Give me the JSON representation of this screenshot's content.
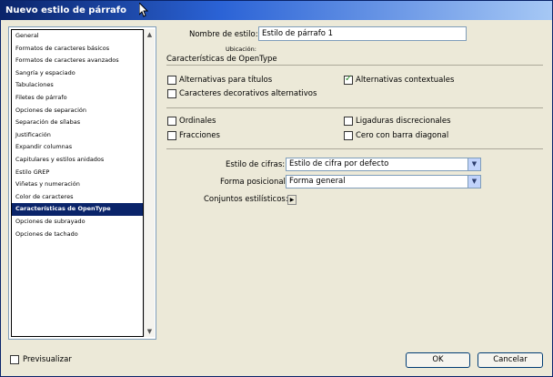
{
  "window": {
    "title": "Nuevo estilo de párrafo"
  },
  "sidebar": {
    "items": [
      {
        "label": "General"
      },
      {
        "label": "Formatos de caracteres básicos"
      },
      {
        "label": "Formatos de caracteres avanzados"
      },
      {
        "label": "Sangría y espaciado"
      },
      {
        "label": "Tabulaciones"
      },
      {
        "label": "Filetes de párrafo"
      },
      {
        "label": "Opciones de separación"
      },
      {
        "label": "Separación de sílabas"
      },
      {
        "label": "Justificación"
      },
      {
        "label": "Expandir columnas"
      },
      {
        "label": "Capitulares y estilos anidados"
      },
      {
        "label": "Estilo GREP"
      },
      {
        "label": "Viñetas y numeración"
      },
      {
        "label": "Color de caracteres"
      },
      {
        "label": "Características de OpenType"
      },
      {
        "label": "Opciones de subrayado"
      },
      {
        "label": "Opciones de tachado"
      }
    ],
    "selected_index": 14
  },
  "main": {
    "style_name_label": "Nombre de estilo:",
    "style_name_value": "Estilo de párrafo 1",
    "location_label": "Ubicación:",
    "section_title": "Características de OpenType",
    "checkboxes": {
      "titling_alternates": {
        "label": "Alternativas para títulos",
        "checked": false
      },
      "contextual_alternates": {
        "label": "Alternativas contextuales",
        "checked": true
      },
      "swash": {
        "label": "Caracteres decorativos alternativos",
        "checked": false
      },
      "ordinals": {
        "label": "Ordinales",
        "checked": false
      },
      "discretionary_ligatures": {
        "label": "Ligaduras discrecionales",
        "checked": false
      },
      "fractions": {
        "label": "Fracciones",
        "checked": false
      },
      "slashed_zero": {
        "label": "Cero con barra diagonal",
        "checked": false
      }
    },
    "figure_style_label": "Estilo de cifras:",
    "figure_style_value": "Estilo de cifra por defecto",
    "positional_form_label": "Forma posicional:",
    "positional_form_value": "Forma general",
    "stylistic_sets_label": "Conjuntos estilísticos:"
  },
  "footer": {
    "preview_label": "Previsualizar",
    "preview_checked": false,
    "ok_label": "OK",
    "cancel_label": "Cancelar"
  }
}
